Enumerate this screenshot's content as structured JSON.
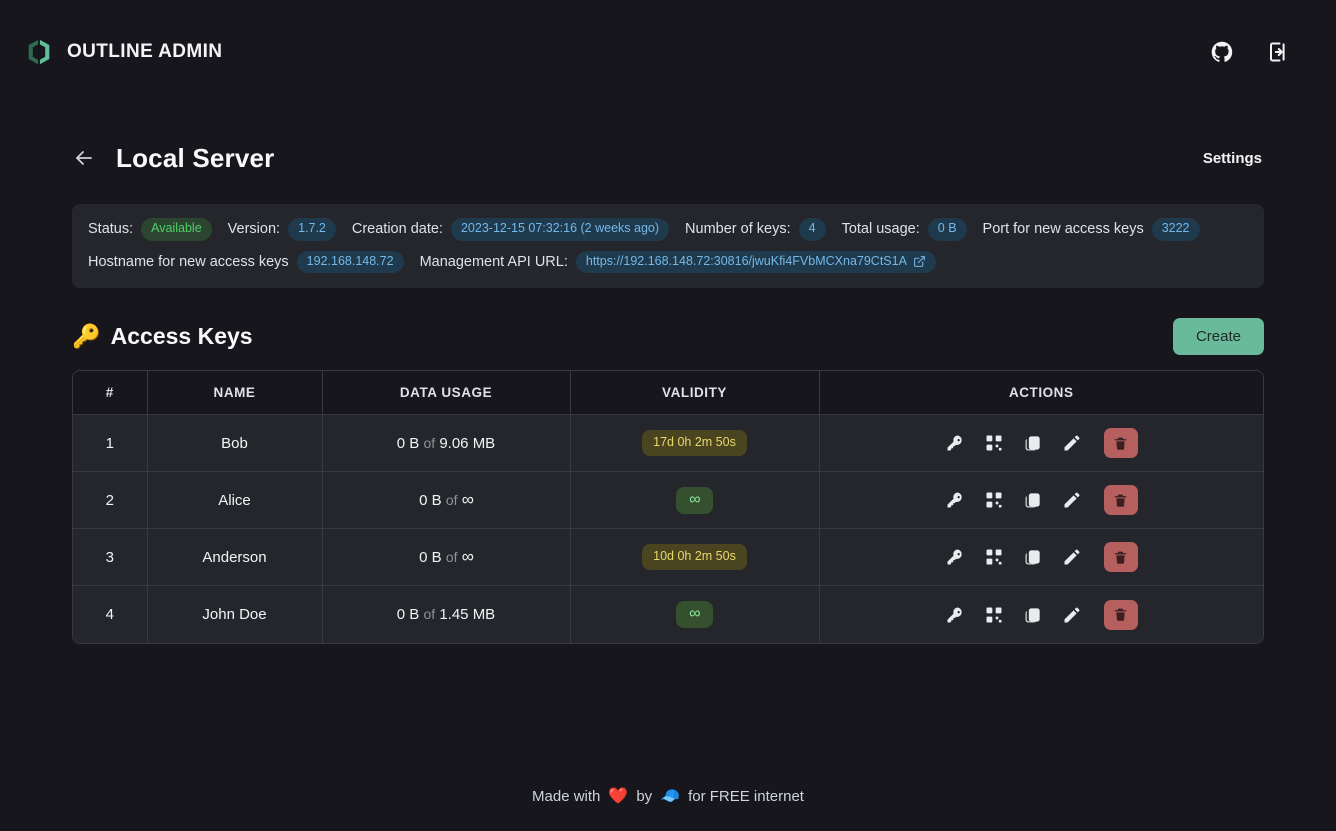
{
  "navbar": {
    "brand": "OUTLINE ADMIN",
    "logo_icon": "outline-hex-logo",
    "icons": [
      {
        "name": "github-icon",
        "label": "GitHub"
      },
      {
        "name": "logout-icon",
        "label": "Logout"
      }
    ]
  },
  "page": {
    "back_icon": "arrow-left-icon",
    "title": "Local Server",
    "settings_label": "Settings"
  },
  "server_info": {
    "status_label": "Status:",
    "status_value": "Available",
    "version_label": "Version:",
    "version_value": "1.7.2",
    "creation_label": "Creation date:",
    "creation_value": "2023-12-15 07:32:16 (2 weeks ago)",
    "keys_label": "Number of keys:",
    "keys_value": "4",
    "usage_label": "Total usage:",
    "usage_value": "0 B",
    "port_label": "Port for new access keys",
    "port_value": "3222",
    "hostname_label": "Hostname for new access keys",
    "hostname_value": "192.168.148.72",
    "api_label": "Management API URL:",
    "api_value": "https://192.168.148.72:30816/jwuKfi4FVbMCXna79CtS1A"
  },
  "access_keys": {
    "emoji": "🔑",
    "title": "Access Keys",
    "create_label": "Create",
    "columns": [
      "#",
      "NAME",
      "DATA USAGE",
      "VALIDITY",
      "ACTIONS"
    ],
    "rows": [
      {
        "num": "1",
        "name": "Bob",
        "usage_used": "0 B",
        "usage_of": "of",
        "usage_total": "9.06 MB",
        "validity": "17d 0h 2m 50s",
        "validity_type": "olive"
      },
      {
        "num": "2",
        "name": "Alice",
        "usage_used": "0 B",
        "usage_of": "of",
        "usage_total": "∞",
        "validity": "∞",
        "validity_type": "green"
      },
      {
        "num": "3",
        "name": "Anderson",
        "usage_used": "0 B",
        "usage_of": "of",
        "usage_total": "∞",
        "validity": "10d 0h 2m 50s",
        "validity_type": "olive"
      },
      {
        "num": "4",
        "name": "John Doe",
        "usage_used": "0 B",
        "usage_of": "of",
        "usage_total": "1.45 MB",
        "validity": "∞",
        "validity_type": "green"
      }
    ],
    "action_icons": [
      "key-icon",
      "qrcode-icon",
      "copy-icon",
      "edit-pencil-icon",
      "delete-trash-icon"
    ]
  },
  "footer": {
    "made_with": "Made with",
    "heart": "❤️",
    "by": "by",
    "cap": "🧢",
    "tail": "for FREE internet"
  },
  "colors": {
    "background": "#16161c",
    "surface": "#25262b",
    "border": "#373a40",
    "accent_green": "#69b99d",
    "status_green": "#51cf66",
    "pill_blue": "#74b8e8",
    "danger": "#b55f5f",
    "olive_badge": "#e8d96b"
  }
}
